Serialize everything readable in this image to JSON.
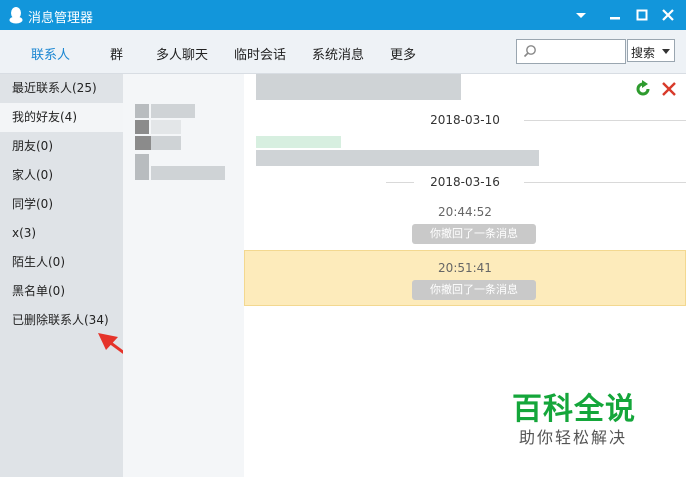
{
  "window": {
    "title": "消息管理器"
  },
  "tabs": [
    {
      "label": "联系人",
      "active": true
    },
    {
      "label": "群"
    },
    {
      "label": "多人聊天"
    },
    {
      "label": "临时会话"
    },
    {
      "label": "系统消息"
    },
    {
      "label": "更多"
    }
  ],
  "search": {
    "placeholder": "",
    "button_label": "搜索"
  },
  "sidebar": {
    "items": [
      {
        "label": "最近联系人(25)"
      },
      {
        "label": "我的好友(4)",
        "selected": true
      },
      {
        "label": "朋友(0)"
      },
      {
        "label": "家人(0)"
      },
      {
        "label": "同学(0)"
      },
      {
        "label": "x(3)"
      },
      {
        "label": "陌生人(0)"
      },
      {
        "label": "黑名单(0)"
      },
      {
        "label": "已删除联系人(34)"
      }
    ]
  },
  "chat": {
    "date1": "2018-03-10",
    "date2": "2018-03-16",
    "messages": [
      {
        "time": "20:44:52",
        "text": "你撤回了一条消息"
      },
      {
        "time": "20:51:41",
        "text": "你撤回了一条消息",
        "highlighted": true
      }
    ]
  },
  "watermark": {
    "main": "百科全说",
    "sub": "助你轻松解决"
  },
  "colors": {
    "titlebar": "#1296db",
    "accent": "#1a86d2",
    "highlight": "#fdebbb",
    "arrow": "#e5332a",
    "watermark": "#14a63a"
  }
}
